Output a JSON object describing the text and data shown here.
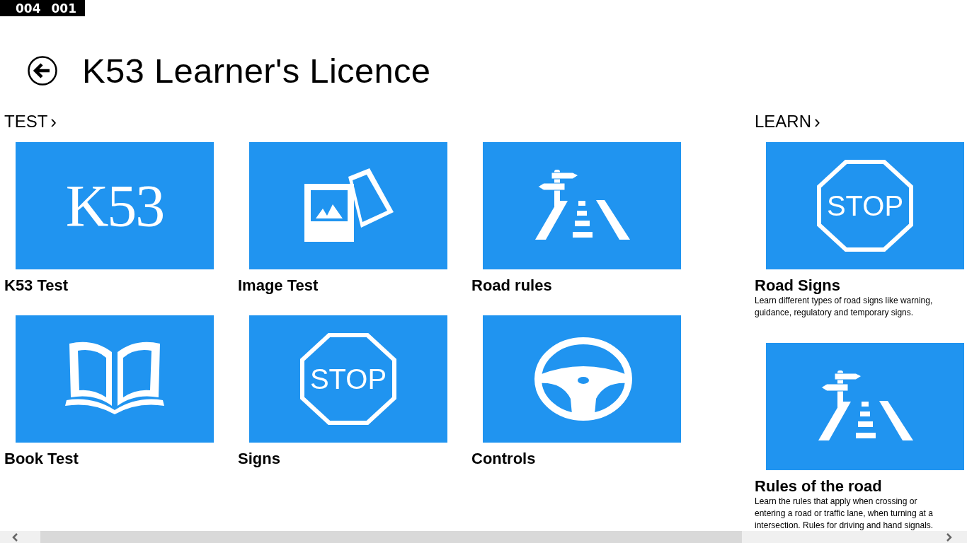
{
  "debug_counter": [
    "004",
    "001"
  ],
  "header": {
    "title": "K53 Learner's Licence"
  },
  "sections": [
    {
      "heading": "TEST",
      "chevron": "›",
      "tiles": [
        {
          "kind": "k53",
          "icon_text": "K53",
          "label": "K53 Test"
        },
        {
          "kind": "image",
          "label": "Image Test"
        },
        {
          "kind": "road",
          "label": "Road rules"
        },
        {
          "kind": "book",
          "label": "Book Test"
        },
        {
          "kind": "stop",
          "icon_text": "STOP",
          "label": "Signs"
        },
        {
          "kind": "wheel",
          "label": "Controls"
        }
      ]
    },
    {
      "heading": "LEARN",
      "chevron": "›",
      "tiles": [
        {
          "kind": "stop",
          "icon_text": "STOP",
          "label": "Road Signs",
          "description": "Learn different types of road signs like warning, guidance, regulatory and temporary signs."
        },
        {
          "kind": "road",
          "label": "Rules of the road",
          "description": "Learn the rules that apply when crossing or entering a road or traffic lane, when turning at a intersection. Rules for driving and hand signals."
        }
      ]
    }
  ]
}
